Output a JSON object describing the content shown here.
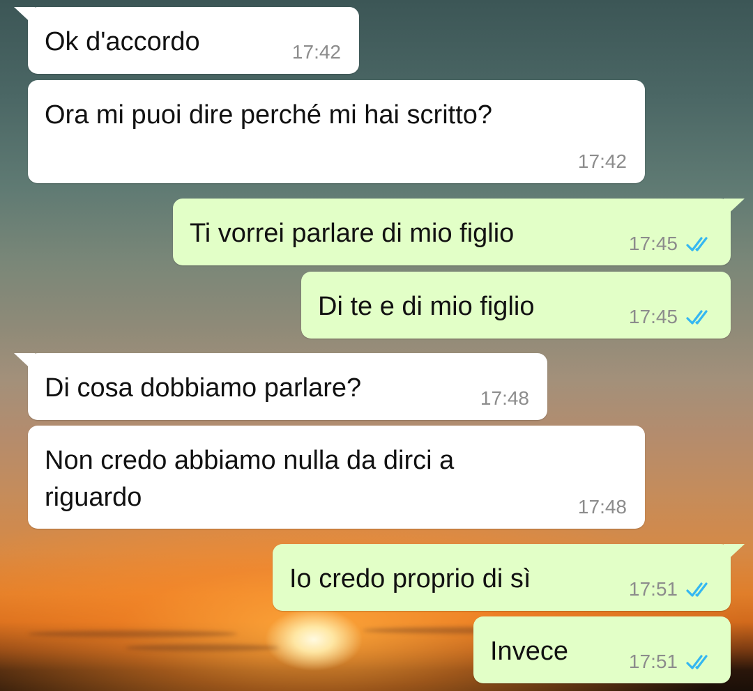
{
  "conversation": {
    "messages": [
      {
        "direction": "in",
        "text": "Ok d'accordo",
        "time": "17:42"
      },
      {
        "direction": "in",
        "text": "Ora mi puoi dire perché mi hai scritto?",
        "time": "17:42"
      },
      {
        "direction": "out",
        "text": "Ti vorrei parlare di mio figlio",
        "time": "17:45",
        "status": "read"
      },
      {
        "direction": "out",
        "text": "Di te e di mio figlio",
        "time": "17:45",
        "status": "read"
      },
      {
        "direction": "in",
        "text": "Di cosa dobbiamo parlare?",
        "time": "17:48"
      },
      {
        "direction": "in",
        "text": "Non credo abbiamo nulla da dirci a\nriguardo",
        "time": "17:48"
      },
      {
        "direction": "out",
        "text": "Io credo proprio di sì",
        "time": "17:51",
        "status": "read"
      },
      {
        "direction": "out",
        "text": "Invece",
        "time": "17:51",
        "status": "read"
      }
    ]
  },
  "colors": {
    "incoming_bubble": "#ffffff",
    "outgoing_bubble": "#e2ffc7",
    "read_ticks": "#34b7f1",
    "timestamp": "#8c8c8c"
  },
  "icons": {
    "read_status": "double-check-icon"
  }
}
